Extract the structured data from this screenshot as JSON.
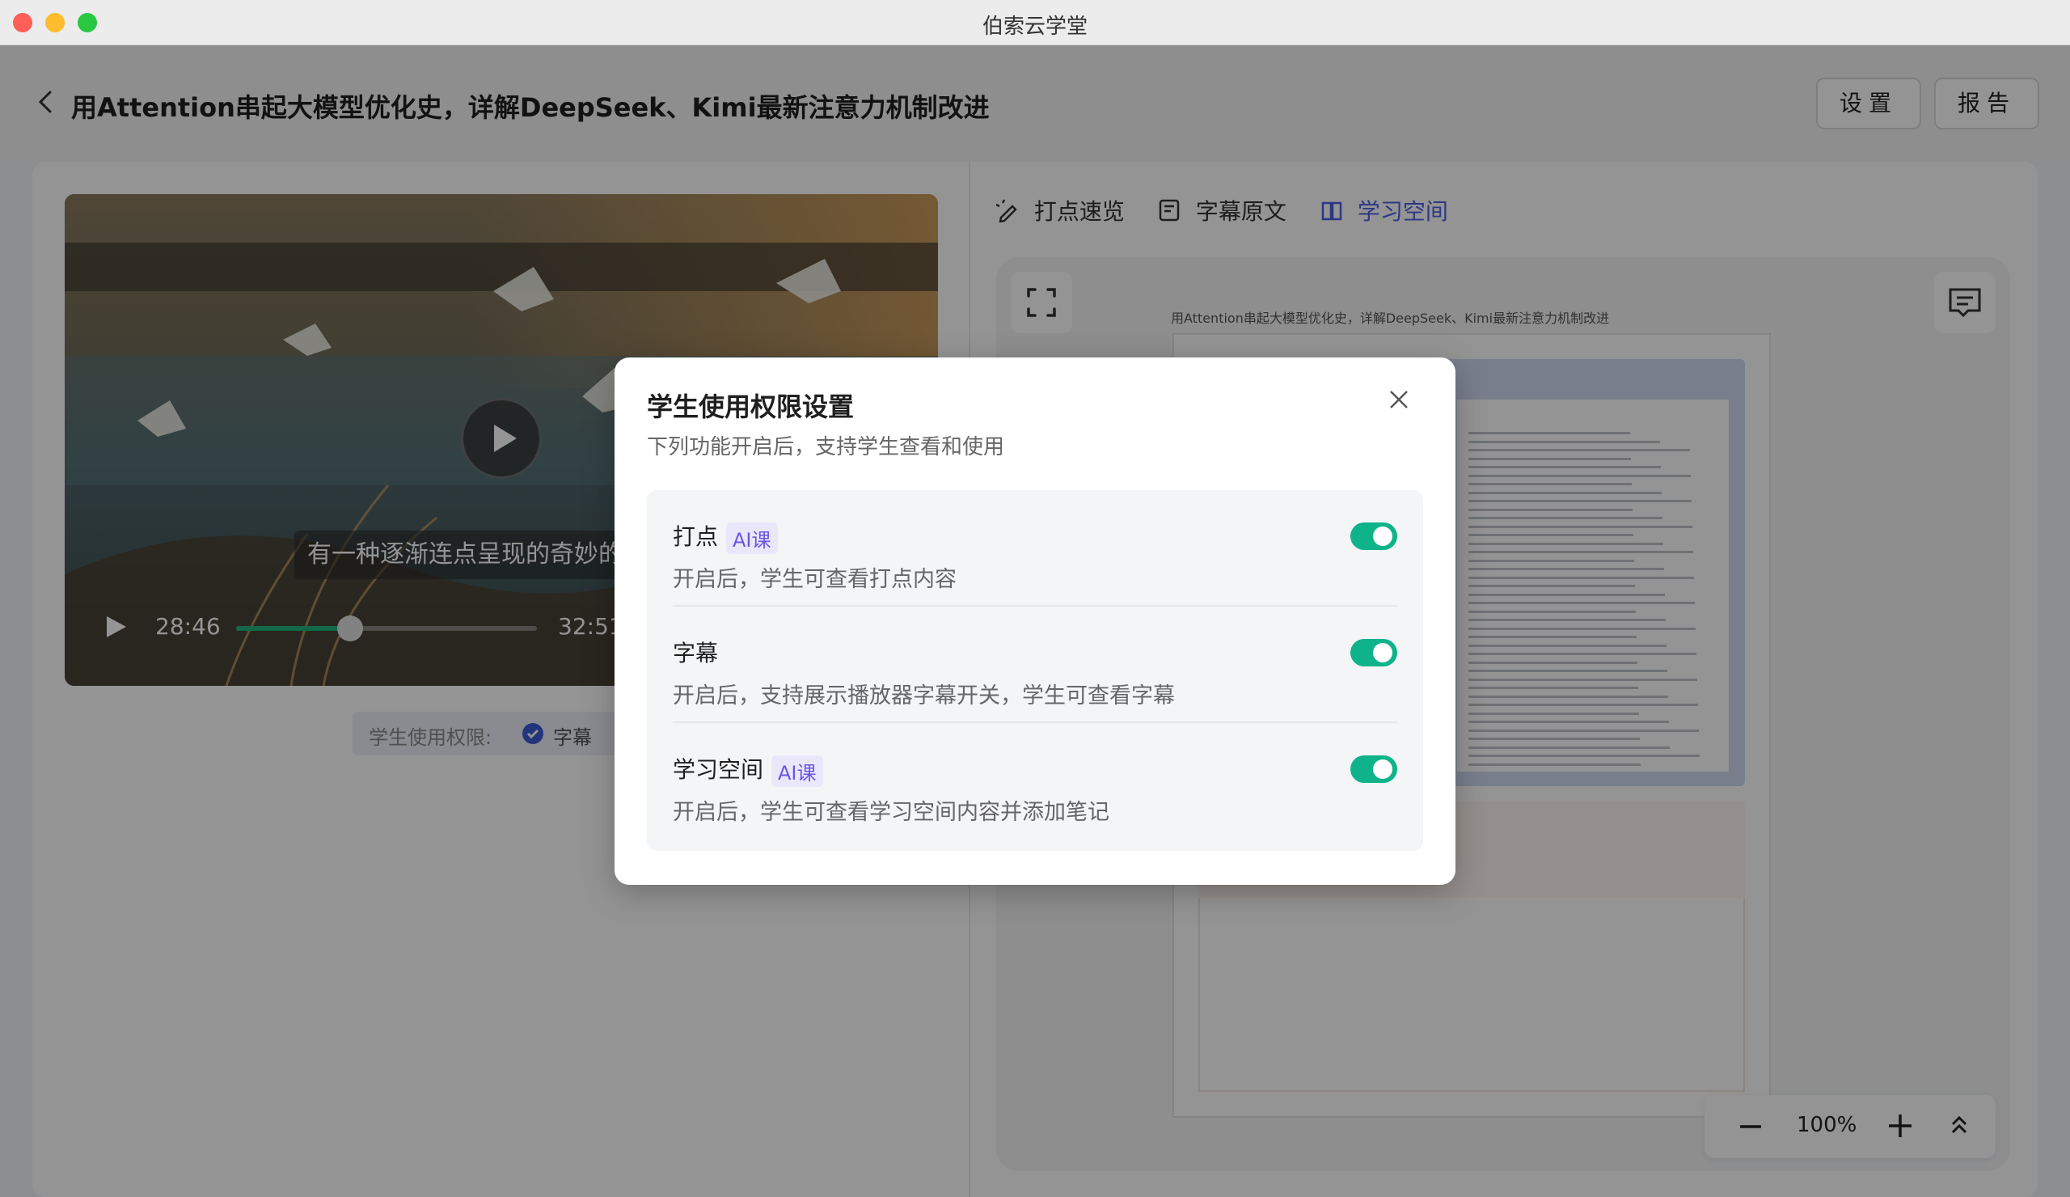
{
  "app": {
    "title": "伯索云学堂"
  },
  "header": {
    "title": "用Attention串起大模型优化史，详解DeepSeek、Kimi最新注意力机制改进",
    "settings_label": "设置",
    "report_label": "报告"
  },
  "player": {
    "subtitle_text": "有一种逐渐连点呈现的奇妙的",
    "current_time": "28:46",
    "total_time": "32:51",
    "progress": 0.38
  },
  "permissions_bar": {
    "label": "学生使用权限:",
    "item": "字幕"
  },
  "tabs": [
    {
      "label": "打点速览",
      "icon": "pen-sparkle-icon"
    },
    {
      "label": "字幕原文",
      "icon": "subtitle-doc-icon"
    },
    {
      "label": "学习空间",
      "icon": "study-space-icon"
    }
  ],
  "doc": {
    "title": "用Attention串起大模型优化史，详解DeepSeek、Kimi最新注意力机制改进"
  },
  "zoom": {
    "value": "100%"
  },
  "modal": {
    "title": "学生使用权限设置",
    "subtitle": "下列功能开启后，支持学生查看和使用",
    "rows": [
      {
        "name": "打点",
        "badge": "AI课",
        "desc": "开启后，学生可查看打点内容",
        "enabled": true
      },
      {
        "name": "字幕",
        "badge": "",
        "desc": "开启后，支持展示播放器字幕开关，学生可查看字幕",
        "enabled": true
      },
      {
        "name": "学习空间",
        "badge": "AI课",
        "desc": "开启后，学生可查看学习空间内容并添加笔记",
        "enabled": true
      }
    ]
  },
  "colors": {
    "accent": "#4e5fe6",
    "toggle_on": "#0fb38a",
    "badge": "#6a56e0"
  }
}
